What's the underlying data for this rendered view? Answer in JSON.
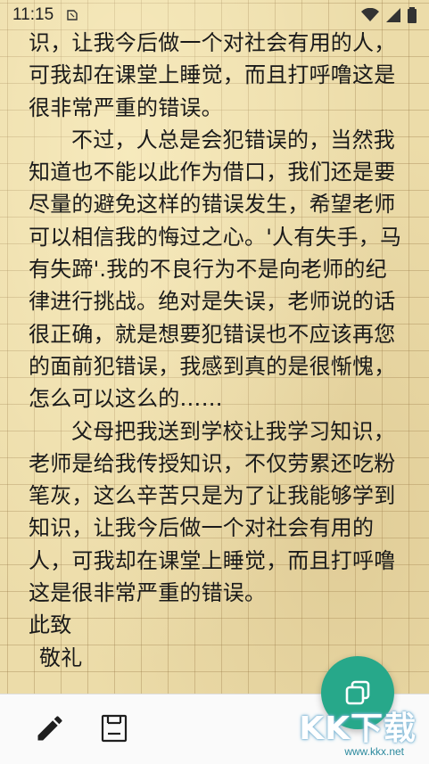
{
  "status_bar": {
    "time": "11:15",
    "icons": [
      "note-icon",
      "wifi-icon",
      "signal-icon",
      "battery-icon"
    ]
  },
  "letter": {
    "top_partial": "父母把我送到学校让我学习知识，老师是给我传授知识，不仅劳累还吃粉笔灰，这么辛苦只是为了让我能够学到知",
    "lines_p1": [
      "识，让我今后做一个对社会有用的人，",
      "可我却在课堂上睡觉，而且打呼噜这是",
      "很非常严重的错误。"
    ],
    "paragraph2": "不过，人总是会犯错误的，当然我知道也不能以此作为借口，我们还是要尽量的避免这样的错误发生，希望老师可以相信我的悔过之心。'人有失手，马有失蹄'.我的不良行为不是向老师的纪律进行挑战。绝对是失误，老师说的话很正确，就是想要犯错误也不应该再您的面前犯错误，我感到真的是很惭愧，怎么可以这么的……",
    "paragraph3": "父母把我送到学校让我学习知识，老师是给我传授知识，不仅劳累还吃粉笔灰，这么辛苦只是为了让我能够学到知识，让我今后做一个对社会有用的人，可我却在课堂上睡觉，而且打呼噜这是很非常严重的错误。",
    "closing_1": "此致",
    "closing_2": "敬礼"
  },
  "toolbar": {
    "edit_icon": "pencil-icon",
    "save_icon": "save-icon"
  },
  "fab": {
    "icon": "copy-icon",
    "color": "#27a88a"
  },
  "watermark": {
    "main": "KK下载",
    "sub": "www.kkx.net"
  }
}
